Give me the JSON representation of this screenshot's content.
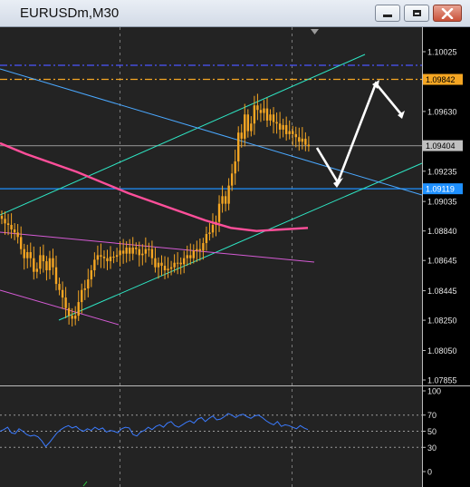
{
  "window": {
    "title": "EURUSDm,M30"
  },
  "chart_data": [
    {
      "type": "candlestick",
      "symbol": "EURUSDm",
      "timeframe": "M30",
      "y_ticks": [
        "1.10025",
        "1.09630",
        "1.09235",
        "1.09035",
        "1.08840",
        "1.08645",
        "1.08445",
        "1.08250",
        "1.08050",
        "1.07855"
      ],
      "y_range": [
        1.0781,
        1.1012
      ],
      "price_labels": [
        {
          "text": "1.09842",
          "value": 1.09842,
          "color": "#f5a623"
        },
        {
          "text": "1.09404",
          "value": 1.09404,
          "color": "#c0c0c0"
        },
        {
          "text": "1.09119",
          "value": 1.09119,
          "color": "#1e90ff"
        }
      ],
      "horizontal_lines": [
        {
          "value": 1.09935,
          "color": "#4b56ff",
          "style": "dash-dot"
        },
        {
          "value": 1.09842,
          "color": "#f5a623",
          "style": "dash-dot"
        },
        {
          "value": 1.09404,
          "color": "#808080",
          "style": "solid"
        },
        {
          "value": 1.09119,
          "color": "#1e90ff",
          "style": "solid"
        }
      ],
      "close_series": [
        1.0892,
        1.0889,
        1.0888,
        1.0885,
        1.0883,
        1.088,
        1.0872,
        1.0866,
        1.087,
        1.0866,
        1.0857,
        1.0859,
        1.0868,
        1.0864,
        1.0858,
        1.0866,
        1.086,
        1.0849,
        1.0845,
        1.084,
        1.0833,
        1.0828,
        1.0826,
        1.0828,
        1.0837,
        1.0845,
        1.0846,
        1.0852,
        1.0858,
        1.0865,
        1.0868,
        1.0867,
        1.0866,
        1.0864,
        1.0867,
        1.0867,
        1.0868,
        1.0871,
        1.0869,
        1.0873,
        1.0869,
        1.0873,
        1.0872,
        1.0868,
        1.0869,
        1.0872,
        1.0872,
        1.0866,
        1.086,
        1.0863,
        1.0861,
        1.0858,
        1.0859,
        1.086,
        1.0863,
        1.0863,
        1.0862,
        1.0866,
        1.0868,
        1.0866,
        1.0871,
        1.0872,
        1.0871,
        1.0876,
        1.0882,
        1.0883,
        1.0888,
        1.089,
        1.0902,
        1.0907,
        1.0902,
        1.0914,
        1.0922,
        1.093,
        1.0949,
        1.0945,
        1.0961,
        1.095,
        1.0955,
        1.0967,
        1.0964,
        1.0962,
        1.0965,
        1.0957,
        1.0961,
        1.0956,
        1.0955,
        1.0951,
        1.0954,
        1.0948,
        1.095,
        1.0948,
        1.0946,
        1.0943,
        1.0945,
        1.0941,
        1.094
      ],
      "moving_average": {
        "color": "#ff4f9a",
        "values": [
          1.0942,
          1.0935,
          1.0929,
          1.0923,
          1.0916,
          1.0909,
          1.0903,
          1.0897,
          1.0891,
          1.0886,
          1.0884,
          1.0885,
          1.0886
        ]
      },
      "trendlines": [
        {
          "name": "upper-channel",
          "color": "#2ee6c4"
        },
        {
          "name": "lower-channel",
          "color": "#2ee6c4"
        },
        {
          "name": "descending-line",
          "color": "#4aa8ff"
        },
        {
          "name": "magenta-upper",
          "color": "#d55bd5"
        },
        {
          "name": "magenta-lower",
          "color": "#d55bd5"
        }
      ],
      "projection_arrow_color": "#ffffff"
    },
    {
      "type": "line",
      "panel": "oscillator",
      "y_ticks": [
        "100",
        "70",
        "50",
        "30",
        "0"
      ],
      "y_range": [
        0,
        100
      ],
      "levels": [
        70,
        50,
        30
      ],
      "series": [
        {
          "color": "#3b7bff",
          "values": [
            50,
            52,
            55,
            48,
            47,
            53,
            50,
            46,
            44,
            45,
            43,
            38,
            31,
            36,
            42,
            48,
            52,
            55,
            57,
            54,
            56,
            52,
            50,
            53,
            51,
            55,
            52,
            54,
            49,
            51,
            50,
            48,
            53,
            55,
            54,
            46,
            44,
            49,
            51,
            55,
            52,
            56,
            58,
            55,
            60,
            62,
            57,
            55,
            58,
            61,
            63,
            60,
            65,
            67,
            62,
            66,
            69,
            64,
            65,
            68,
            72,
            70,
            67,
            70,
            71,
            68,
            66,
            69,
            70,
            67,
            63,
            60,
            58,
            62,
            56,
            58,
            57,
            55,
            53,
            57,
            54,
            52
          ]
        }
      ]
    }
  ]
}
